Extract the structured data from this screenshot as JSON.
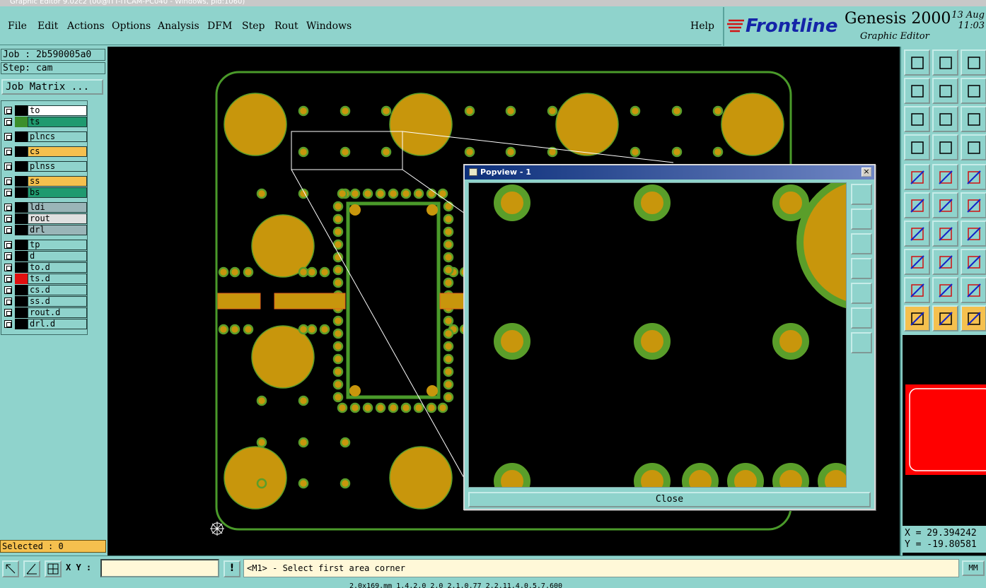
{
  "window": {
    "title": "Graphic Editor 9.02c2 (00@ITT-ITCAM-PC040 - Windows, pid:1060)"
  },
  "menu": [
    "File",
    "Edit",
    "Actions",
    "Options",
    "Analysis",
    "DFM",
    "Step",
    "Rout",
    "Windows"
  ],
  "help": "Help",
  "brand": {
    "logo": "Frontline",
    "title": "Genesis 2000",
    "subtitle": "Graphic Editor",
    "date": "13 Aug",
    "time": "11:03"
  },
  "job": {
    "job_text": "Job : 2b590005a0",
    "step_text": "Step: cam",
    "matrix_button": "Job Matrix ..."
  },
  "layers": [
    {
      "name": "to",
      "color": "#ffffff",
      "swatch": "#000000"
    },
    {
      "name": "ts",
      "color": "#1f9a6f",
      "swatch": "#3c8f2c"
    },
    {
      "name": "plncs",
      "color": "#8fd3cc",
      "swatch": "#000000"
    },
    {
      "name": "cs",
      "color": "#f5c04e",
      "swatch": "#000000"
    },
    {
      "name": "plnss",
      "color": "#8fd3cc",
      "swatch": "#000000"
    },
    {
      "name": "ss",
      "color": "#f5c04e",
      "swatch": "#000000"
    },
    {
      "name": "bs",
      "color": "#1f9a6f",
      "swatch": "#000000"
    },
    {
      "name": "ldi",
      "color": "#9ab5b8",
      "swatch": "#000000"
    },
    {
      "name": "rout",
      "color": "#e0e0e0",
      "swatch": "#000000"
    },
    {
      "name": "drl",
      "color": "#9ab5b8",
      "swatch": "#000000"
    },
    {
      "name": "tp",
      "color": "#8fd3cc",
      "swatch": "#000000"
    },
    {
      "name": "d",
      "color": "#8fd3cc",
      "swatch": "#000000"
    },
    {
      "name": "to.d",
      "color": "#8fd3cc",
      "swatch": "#000000"
    },
    {
      "name": "ts.d",
      "color": "#8fd3cc",
      "swatch": "#e01010"
    },
    {
      "name": "cs.d",
      "color": "#8fd3cc",
      "swatch": "#000000"
    },
    {
      "name": "ss.d",
      "color": "#8fd3cc",
      "swatch": "#000000"
    },
    {
      "name": "rout.d",
      "color": "#8fd3cc",
      "swatch": "#000000"
    },
    {
      "name": "drl.d",
      "color": "#8fd3cc",
      "swatch": "#000000"
    }
  ],
  "selected_text": "Selected : 0",
  "coords": {
    "x": "X = 29.394242",
    "y": "Y = -19.80581"
  },
  "bottom": {
    "xy_label": "X Y :",
    "xy_value": "",
    "prompt": "<M1> - Select first area corner",
    "units": "MM",
    "status_line": "2.0x169.mm 1.4.2.0  2.0  2.1.0.77  2.2.11.4.0.5.7.600"
  },
  "popview": {
    "title": "Popview - 1",
    "close_label": "Close"
  },
  "colors": {
    "pad": "#c8960c",
    "pad_ring": "#5a9e2a",
    "board_outline": "#4a9a2a",
    "selection": "#ffffff",
    "active_layer": "#e01010"
  },
  "icons": {
    "tools": [
      "zoom-home-icon",
      "zoom-in-icon",
      "zoom-all-icon",
      "pan-left-icon",
      "pan-right-icon",
      "undo-view-icon",
      "fit-icon",
      "center-icon",
      "ratio-icon",
      "measure-icon",
      "grid-icon",
      "snap-icon",
      "pad-icon",
      "area-icon",
      "ruler-icon",
      "connect-icon",
      "cross-icon",
      "line-icon",
      "slope-icon",
      "draw-icon",
      "arc-icon",
      "node-icon",
      "segment-icon",
      "resize-icon",
      "triangle-icon",
      "polygon-icon",
      "arch-icon",
      "select-icon",
      "pick-icon",
      "window-icon"
    ]
  }
}
